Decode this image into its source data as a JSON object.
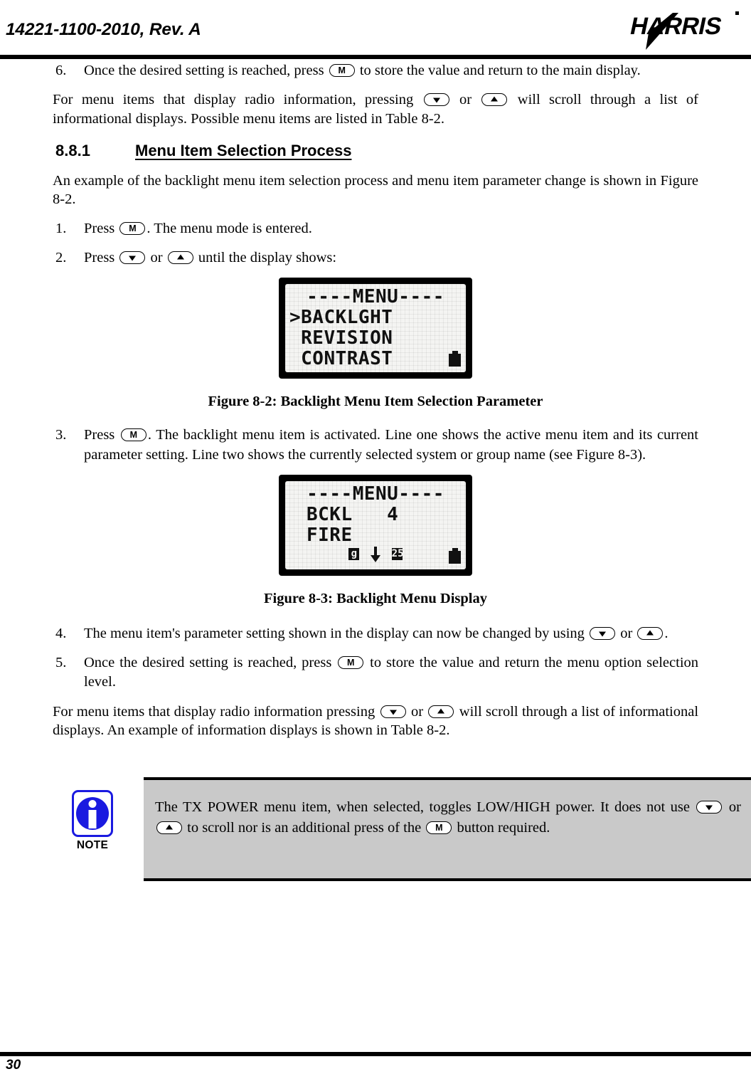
{
  "header": {
    "doc_number": "14221-1100-2010, Rev. A",
    "logo_text": "HARRIS"
  },
  "keys": {
    "menu_label": "M",
    "down_label": "down-triangle",
    "up_label": "up-triangle"
  },
  "steps_top": [
    {
      "num": "6.",
      "text_before": "Once the desired setting is reached, press",
      "text_after": "to store the value and return to the main display."
    }
  ],
  "paragraphs": {
    "intro_scroll_1a": "For menu items that display radio information, pressing",
    "intro_scroll_1b": "or",
    "intro_scroll_1c": "will scroll through a list of informational displays.  Possible menu items are listed in Table 8-2.",
    "example_intro": "An example of the backlight menu item selection process and menu item parameter change is shown in Figure 8-2.",
    "intro_scroll_2a": "For menu items that display radio information pressing",
    "intro_scroll_2b": "or",
    "intro_scroll_2c": "will scroll through a list of informational displays. An example of information displays is shown in Table 8-2."
  },
  "section": {
    "number": "8.8.1",
    "title": "Menu Item Selection Process"
  },
  "steps": [
    {
      "num": "1.",
      "before": "Press",
      "after": ". The menu mode is entered."
    },
    {
      "num": "2.",
      "before": "Press",
      "mid": "or",
      "after": "until the display shows:"
    },
    {
      "num": "3.",
      "before": "Press",
      "after": ".   The backlight menu item is activated. Line one shows the active menu item and its current parameter setting. Line two shows the currently selected system or group name (see Figure 8-3)."
    },
    {
      "num": "4.",
      "before": "The menu item's parameter setting shown in the display can now be changed by using",
      "mid": "or",
      "after": "."
    },
    {
      "num": "5.",
      "before": "Once the desired setting is reached, press",
      "after": "to store the value and return the menu option selection level."
    }
  ],
  "figure1": {
    "lcd": {
      "line1": "----MENU----",
      "line2": ">BACKLGHT",
      "line3": " REVISION",
      "line4": " CONTRAST",
      "battery_icon": "battery-icon"
    },
    "caption": "Figure 8-2: Backlight Menu Item Selection Parameter"
  },
  "figure2": {
    "lcd": {
      "line1": "----MENU----",
      "line2": "BCKL   4",
      "line3": "FIRE",
      "icon_left": "g",
      "icon_arrow": "down-arrow-icon",
      "icon_right": "25",
      "battery_icon": "battery-icon"
    },
    "caption": "Figure 8-3: Backlight Menu Display"
  },
  "note": {
    "label": "NOTE",
    "icon": "info-icon",
    "text_a": "The TX POWER menu item, when selected, toggles LOW/HIGH power.  It does not use",
    "text_b": "or",
    "text_c": "to scroll nor is an additional press of the",
    "text_d": "button required."
  },
  "footer": {
    "page_number": "30"
  },
  "colors": {
    "note_accent": "#1a1ae0",
    "note_background": "#c9c9c9",
    "rule": "#000000"
  }
}
